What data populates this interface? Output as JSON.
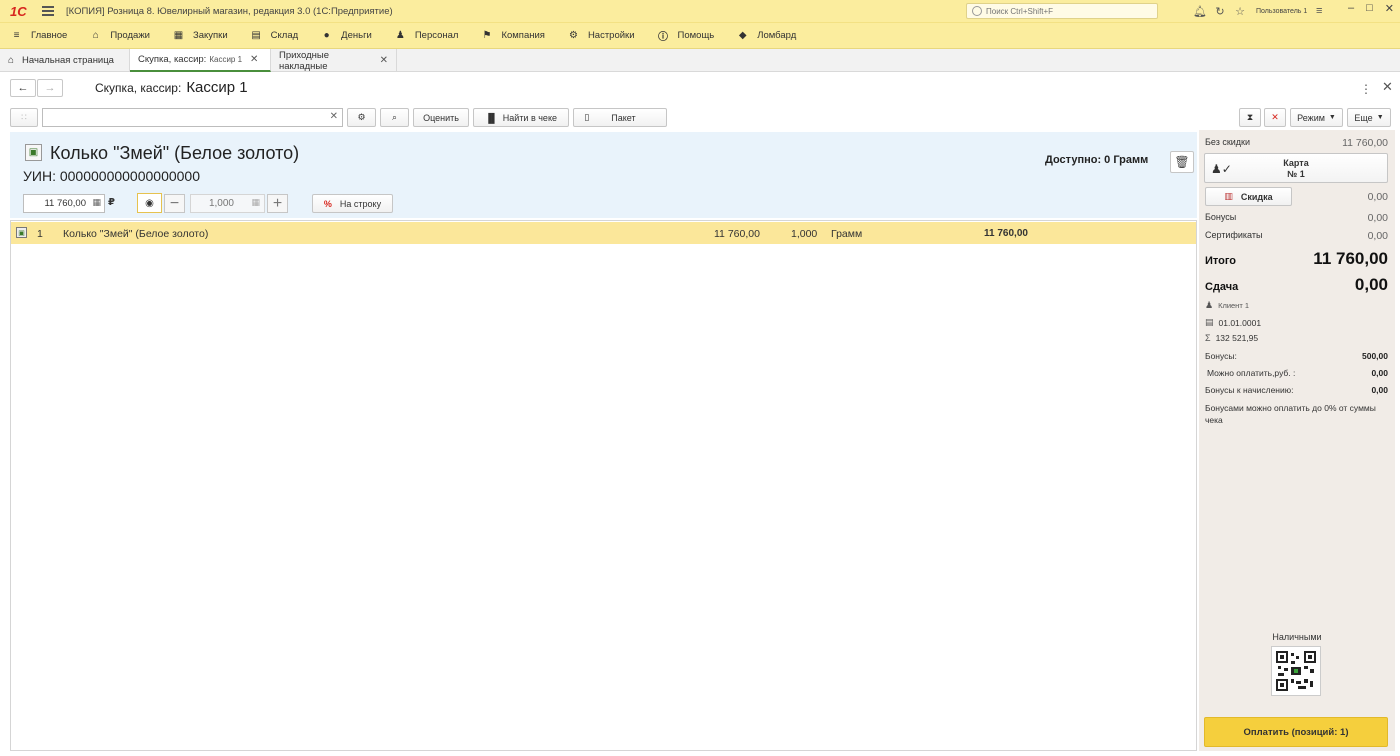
{
  "titlebar": {
    "logo": "1С",
    "app_title": "[КОПИЯ] Розница 8. Ювелирный магазин, редакция 3.0  (1С:Предприятие)",
    "search_placeholder": "Поиск Ctrl+Shift+F",
    "user": "Пользователь 1"
  },
  "menu": {
    "items": [
      {
        "label": "Главное",
        "icon": "hamburger-icon"
      },
      {
        "label": "Продажи",
        "icon": "cart-icon"
      },
      {
        "label": "Закупки",
        "icon": "purchase-icon"
      },
      {
        "label": "Склад",
        "icon": "warehouse-icon"
      },
      {
        "label": "Деньги",
        "icon": "money-icon"
      },
      {
        "label": "Персонал",
        "icon": "people-icon"
      },
      {
        "label": "Компания",
        "icon": "flag-icon"
      },
      {
        "label": "Настройки",
        "icon": "gear-icon"
      },
      {
        "label": "Помощь",
        "icon": "help-icon"
      },
      {
        "label": "Ломбард",
        "icon": "diamond-icon"
      }
    ]
  },
  "tabs": [
    {
      "label": "Начальная страница",
      "sub": "",
      "closable": false,
      "active": false
    },
    {
      "label": "Скупка, кассир:",
      "sub": "Кассир 1",
      "closable": true,
      "active": true
    },
    {
      "label": "Приходные накладные",
      "sub": "",
      "closable": true,
      "active": false
    }
  ],
  "form": {
    "title_prefix": "Скупка, кассир:",
    "title_value": "Кассир 1"
  },
  "toolbar": {
    "evaluate_label": "Оценить",
    "find_in_receipt_label": "Найти в чеке",
    "package_label": "Пакет",
    "mode_label": "Режим",
    "more_label": "Еще"
  },
  "item": {
    "name": "Колько \"Змей\" (Белое золото)",
    "uin": "УИН: 000000000000000000",
    "available": "Доступно: 0 Грамм",
    "price": "11 760,00",
    "currency": "₽",
    "quantity": "1,000",
    "to_row_label": "На строку"
  },
  "table": {
    "rows": [
      {
        "num": "1",
        "name": "Колько \"Змей\" (Белое золото)",
        "price": "11 760,00",
        "qty": "1,000",
        "unit": "Грамм",
        "sum": "11 760,00"
      }
    ]
  },
  "summary": {
    "no_discount_label": "Без скидки",
    "no_discount_value": "11 760,00",
    "card_label": "Карта",
    "card_number": "№ 1",
    "discount_label": "Скидка",
    "discount_value": "0,00",
    "bonuses_label": "Бонусы",
    "bonuses_value": "0,00",
    "certificates_label": "Сертификаты",
    "certificates_value": "0,00",
    "total_label": "Итого",
    "total_value": "11 760,00",
    "change_label": "Сдача",
    "change_value": "0,00",
    "client_name": "Клиент 1",
    "client_date": "01.01.0001",
    "client_sum": "132 521,95",
    "bonus_balance_label": "Бонусы:",
    "bonus_balance_value": "500,00",
    "can_pay_label": "Можно оплатить,руб. :",
    "can_pay_value": "0,00",
    "bonus_accrual_label": "Бонусы к начислению:",
    "bonus_accrual_value": "0,00",
    "bonus_note": "Бонусами можно оплатить до 0% от суммы чека",
    "cash_label": "Наличными",
    "pay_button": "Оплатить (позиций: 1)"
  }
}
